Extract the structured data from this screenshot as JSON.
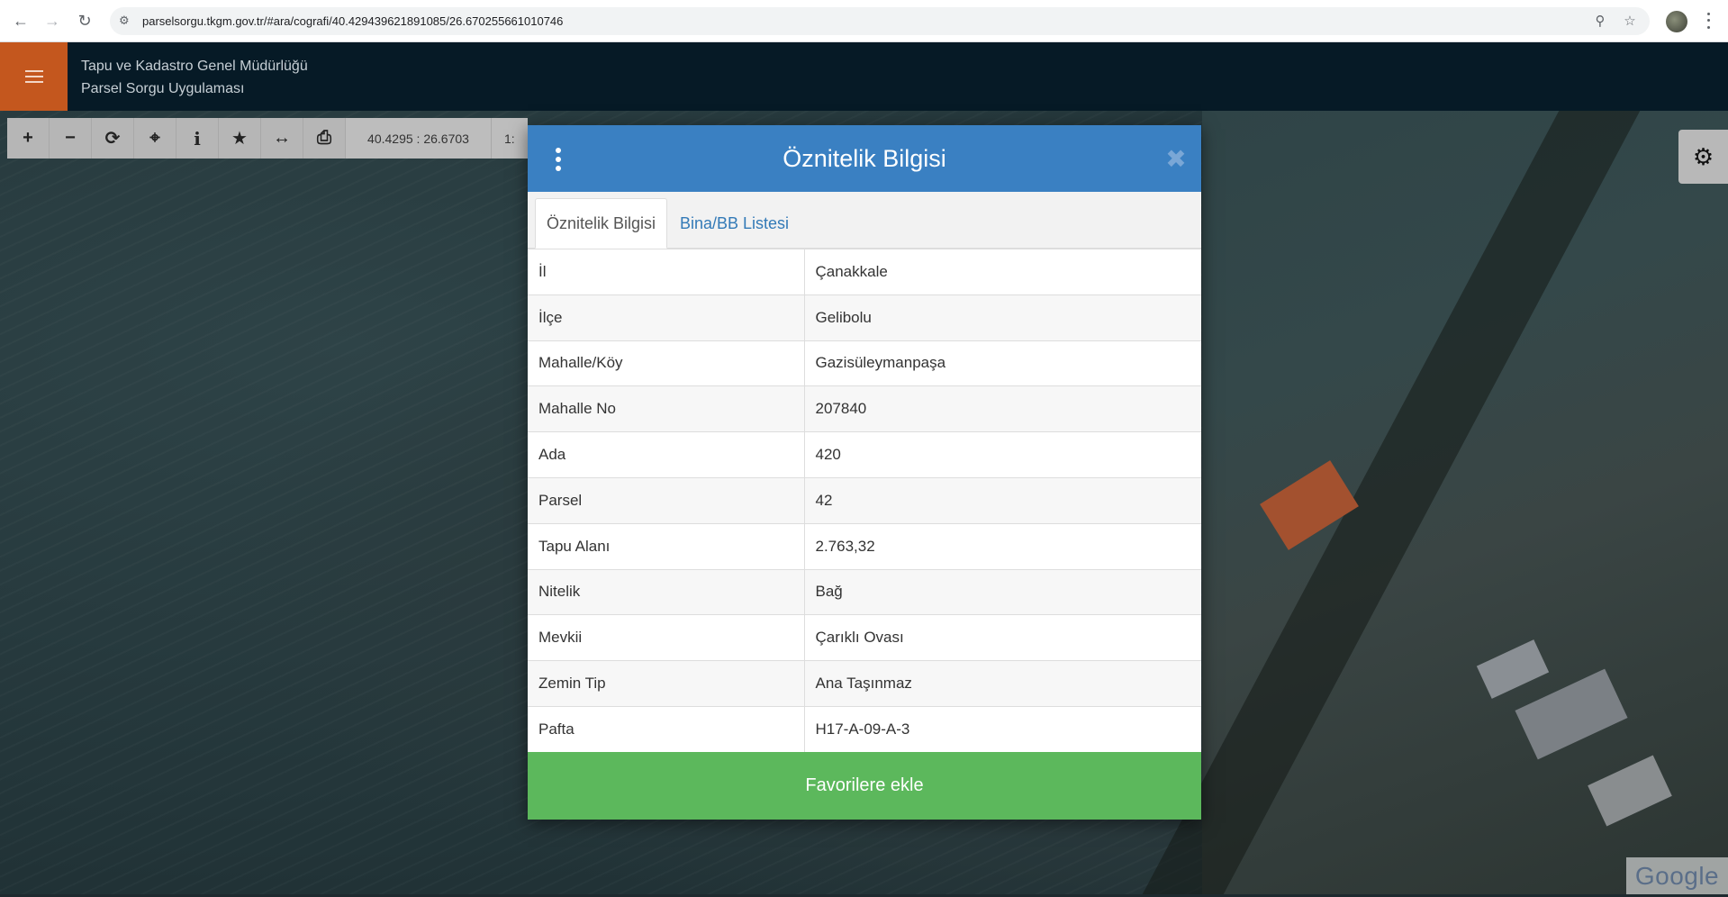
{
  "browser": {
    "url": "parselsorgu.tkgm.gov.tr/#ara/cografi/40.429439621891085/26.670255661010746"
  },
  "app": {
    "title_line1": "Tapu ve Kadastro Genel Müdürlüğü",
    "title_line2": "Parsel Sorgu Uygulaması"
  },
  "toolbar": {
    "coordinates": "40.4295 : 26.6703",
    "scale": "1:"
  },
  "modal": {
    "title": "Öznitelik Bilgisi",
    "tabs": [
      {
        "label": "Öznitelik Bilgisi",
        "active": true
      },
      {
        "label": "Bina/BB Listesi",
        "active": false
      }
    ],
    "rows": [
      {
        "key": "İl",
        "value": "Çanakkale"
      },
      {
        "key": "İlçe",
        "value": "Gelibolu"
      },
      {
        "key": "Mahalle/Köy",
        "value": "Gazisüleymanpaşa"
      },
      {
        "key": "Mahalle No",
        "value": "207840"
      },
      {
        "key": "Ada",
        "value": "420"
      },
      {
        "key": "Parsel",
        "value": "42"
      },
      {
        "key": "Tapu Alanı",
        "value": "2.763,32"
      },
      {
        "key": "Nitelik",
        "value": "Bağ"
      },
      {
        "key": "Mevkii",
        "value": "Çarıklı Ovası"
      },
      {
        "key": "Zemin Tip",
        "value": "Ana Taşınmaz"
      },
      {
        "key": "Pafta",
        "value": "H17-A-09-A-3"
      }
    ],
    "favorite_button": "Favorilere ekle"
  },
  "map": {
    "attribution": "Google"
  },
  "colors": {
    "header_bg": "#061a26",
    "menu_accent": "#c4571e",
    "modal_header": "#3a80c2",
    "favorite_green": "#5cb85c",
    "tab_link": "#337ab7"
  }
}
